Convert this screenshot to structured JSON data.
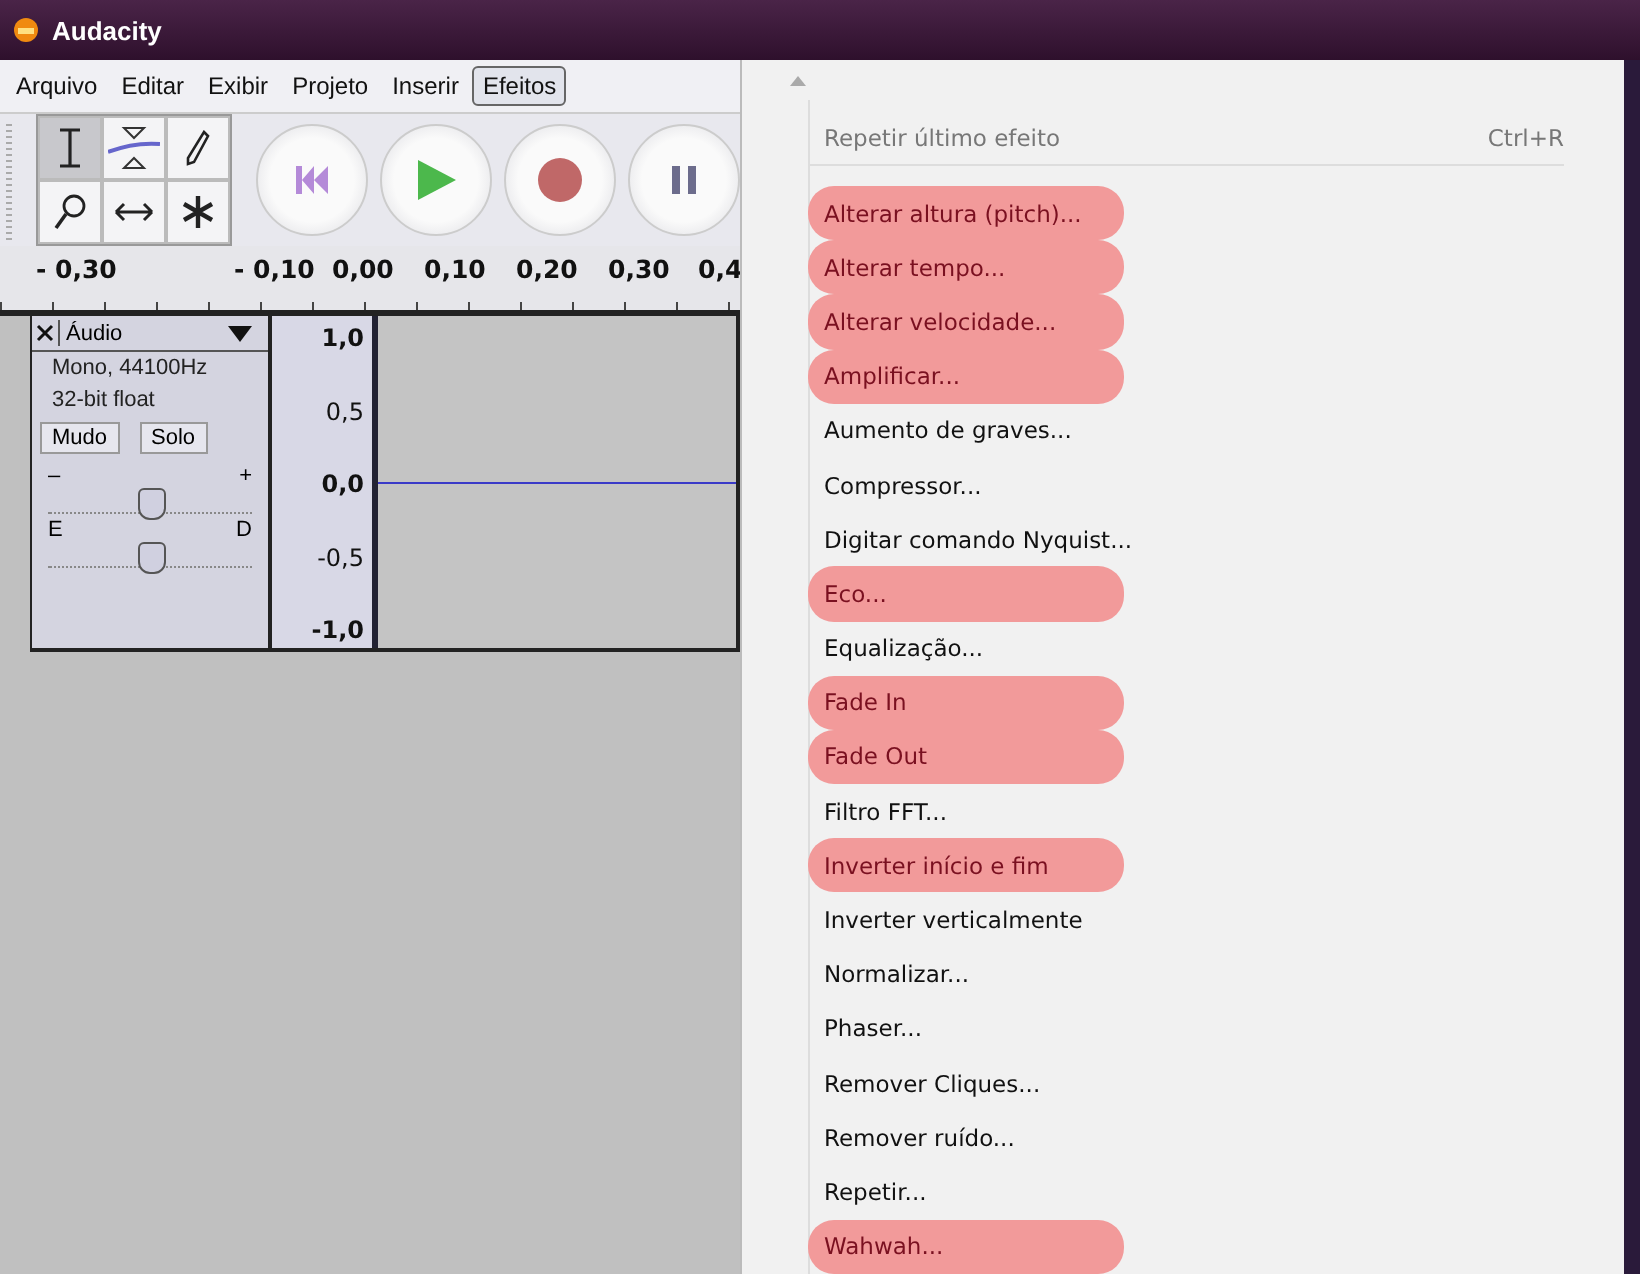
{
  "window": {
    "title": "Audacity"
  },
  "menubar": [
    {
      "label": "Arquivo",
      "selected": false
    },
    {
      "label": "Editar",
      "selected": false
    },
    {
      "label": "Exibir",
      "selected": false
    },
    {
      "label": "Projeto",
      "selected": false
    },
    {
      "label": "Inserir",
      "selected": false
    },
    {
      "label": "Efeitos",
      "selected": true
    }
  ],
  "tools": [
    {
      "kind": "ibeam",
      "selected": true
    },
    {
      "kind": "envelope",
      "selected": false
    },
    {
      "kind": "pencil",
      "selected": false
    },
    {
      "kind": "zoom",
      "selected": false
    },
    {
      "kind": "timeshift",
      "selected": false
    },
    {
      "kind": "multi",
      "selected": false
    }
  ],
  "transport": [
    {
      "kind": "skip-start"
    },
    {
      "kind": "play"
    },
    {
      "kind": "record"
    },
    {
      "kind": "pause"
    }
  ],
  "ruler": [
    "- 0,30",
    "- 0,10",
    "0,00",
    "0,10",
    "0,20",
    "0,30",
    "0,4"
  ],
  "track": {
    "name": "Áudio",
    "info": [
      "Mono, 44100Hz",
      "32-bit float"
    ],
    "buttons": [
      {
        "label": "Mudo",
        "selected": false
      },
      {
        "label": "Solo",
        "selected": false
      }
    ],
    "gain": {
      "min_label": "–",
      "max_label": "+",
      "level": 0.5
    },
    "pan": {
      "min_label": "E",
      "max_label": "D",
      "level": 0.5
    },
    "scale": [
      "1,0",
      "0,5",
      "0,0",
      "-0,5",
      "-1,0"
    ]
  },
  "menu": {
    "items": [
      {
        "label": "Repetir último efeito",
        "shortcut": "Ctrl+R",
        "disabled": true,
        "highlighted": false
      },
      {
        "label": "Alterar altura (pitch)...",
        "disabled": false,
        "highlighted": true
      },
      {
        "label": "Alterar tempo...",
        "disabled": false,
        "highlighted": true
      },
      {
        "label": "Alterar velocidade...",
        "disabled": false,
        "highlighted": true
      },
      {
        "label": "Amplificar...",
        "disabled": false,
        "highlighted": true
      },
      {
        "label": "Aumento de graves...",
        "disabled": false,
        "highlighted": false
      },
      {
        "label": "Compressor...",
        "disabled": false,
        "highlighted": false
      },
      {
        "label": "Digitar comando Nyquist...",
        "disabled": false,
        "highlighted": false
      },
      {
        "label": "Eco...",
        "disabled": false,
        "highlighted": true
      },
      {
        "label": "Equalização...",
        "disabled": false,
        "highlighted": false
      },
      {
        "label": "Fade In",
        "disabled": false,
        "highlighted": true
      },
      {
        "label": "Fade Out",
        "disabled": false,
        "highlighted": true
      },
      {
        "label": "Filtro FFT...",
        "disabled": false,
        "highlighted": false
      },
      {
        "label": "Inverter início e fim",
        "disabled": false,
        "highlighted": true
      },
      {
        "label": "Inverter verticalmente",
        "disabled": false,
        "highlighted": false
      },
      {
        "label": "Normalizar...",
        "disabled": false,
        "highlighted": false
      },
      {
        "label": "Phaser...",
        "disabled": false,
        "highlighted": false
      },
      {
        "label": "Remover Cliques...",
        "disabled": false,
        "highlighted": false
      },
      {
        "label": "Remover ruído...",
        "disabled": false,
        "highlighted": false
      },
      {
        "label": "Repetir...",
        "disabled": false,
        "highlighted": false
      },
      {
        "label": "Wahwah...",
        "disabled": false,
        "highlighted": true
      }
    ]
  }
}
